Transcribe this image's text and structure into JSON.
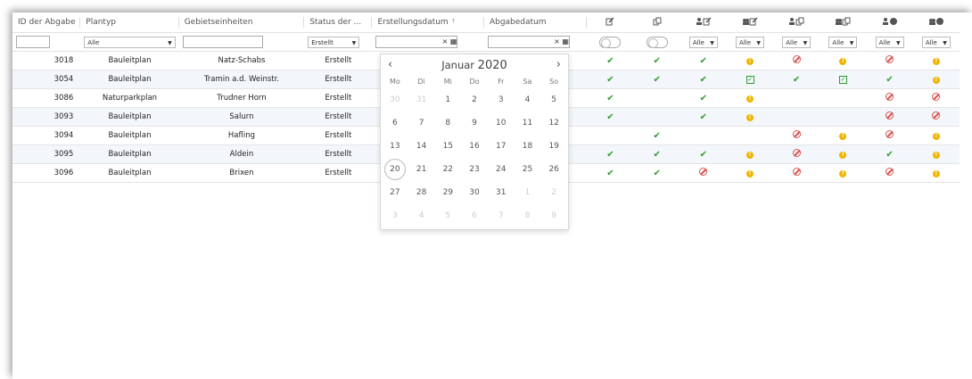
{
  "columns": [
    {
      "label": "ID der Abgabe"
    },
    {
      "label": "Plantyp"
    },
    {
      "label": "Gebietseinheiten"
    },
    {
      "label": "Status der ..."
    },
    {
      "label": "Erstellungsdatum",
      "sort": "↑"
    },
    {
      "label": "Abgabedatum"
    }
  ],
  "icon_columns": [
    "edit-icon",
    "copy-icon",
    "user-edit-icon",
    "group-edit-icon",
    "user-copy-icon",
    "group-copy-icon",
    "user-status-icon",
    "group-status-icon"
  ],
  "filters": {
    "plantyp": "Alle",
    "status": "Erstellt",
    "dropdowns": [
      "Alle",
      "Alle",
      "Alle",
      "Alle",
      "Alle",
      "Alle"
    ],
    "date_clear": "×",
    "date_cal": "▦"
  },
  "rows": [
    {
      "id": "3018",
      "plantyp": "Bauleitplan",
      "gebiet": "Natz-Schabs",
      "status": "Erstellt",
      "icons": [
        "ok",
        "ok",
        "ok",
        "warn",
        "no",
        "warn",
        "no",
        "warn"
      ]
    },
    {
      "id": "3054",
      "plantyp": "Bauleitplan",
      "gebiet": "Tramin a.d. Weinstr.",
      "status": "Erstellt",
      "icons": [
        "ok",
        "ok",
        "ok",
        "chk",
        "ok",
        "chk",
        "ok",
        "warn"
      ]
    },
    {
      "id": "3086",
      "plantyp": "Naturparkplan",
      "gebiet": "Trudner Horn",
      "status": "Erstellt",
      "icons": [
        "ok",
        "",
        "ok",
        "warn",
        "",
        "",
        "no",
        "no"
      ]
    },
    {
      "id": "3093",
      "plantyp": "Bauleitplan",
      "gebiet": "Salurn",
      "status": "Erstellt",
      "icons": [
        "ok",
        "",
        "ok",
        "warn",
        "",
        "",
        "no",
        "no"
      ]
    },
    {
      "id": "3094",
      "plantyp": "Bauleitplan",
      "gebiet": "Hafling",
      "status": "Erstellt",
      "icons": [
        "",
        "ok",
        "",
        "",
        "no",
        "warn",
        "no",
        "warn"
      ]
    },
    {
      "id": "3095",
      "plantyp": "Bauleitplan",
      "gebiet": "Aldein",
      "status": "Erstellt",
      "icons": [
        "ok",
        "ok",
        "ok",
        "warn",
        "no",
        "warn",
        "ok",
        "warn"
      ]
    },
    {
      "id": "3096",
      "plantyp": "Bauleitplan",
      "gebiet": "Brixen",
      "status": "Erstellt",
      "icons": [
        "ok",
        "ok",
        "no",
        "warn",
        "no",
        "warn",
        "no",
        "warn"
      ]
    }
  ],
  "datepicker": {
    "month": "Januar",
    "year": "2020",
    "prev": "‹",
    "next": "›",
    "weekdays": [
      "Mo",
      "Di",
      "Mi",
      "Do",
      "Fr",
      "Sa",
      "So"
    ],
    "weeks": [
      [
        {
          "d": "30",
          "m": true
        },
        {
          "d": "31",
          "m": true
        },
        {
          "d": "1"
        },
        {
          "d": "2"
        },
        {
          "d": "3"
        },
        {
          "d": "4"
        },
        {
          "d": "5"
        }
      ],
      [
        {
          "d": "6"
        },
        {
          "d": "7"
        },
        {
          "d": "8"
        },
        {
          "d": "9"
        },
        {
          "d": "10"
        },
        {
          "d": "11"
        },
        {
          "d": "12"
        }
      ],
      [
        {
          "d": "13"
        },
        {
          "d": "14"
        },
        {
          "d": "15"
        },
        {
          "d": "16"
        },
        {
          "d": "17"
        },
        {
          "d": "18"
        },
        {
          "d": "19"
        }
      ],
      [
        {
          "d": "20",
          "today": true
        },
        {
          "d": "21"
        },
        {
          "d": "22"
        },
        {
          "d": "23"
        },
        {
          "d": "24"
        },
        {
          "d": "25"
        },
        {
          "d": "26"
        }
      ],
      [
        {
          "d": "27"
        },
        {
          "d": "28"
        },
        {
          "d": "29"
        },
        {
          "d": "30"
        },
        {
          "d": "31"
        },
        {
          "d": "1",
          "m": true
        },
        {
          "d": "2",
          "m": true
        }
      ],
      [
        {
          "d": "3",
          "m": true
        },
        {
          "d": "4",
          "m": true
        },
        {
          "d": "5",
          "m": true
        },
        {
          "d": "6",
          "m": true
        },
        {
          "d": "7",
          "m": true
        },
        {
          "d": "8",
          "m": true
        },
        {
          "d": "9",
          "m": true
        }
      ]
    ]
  },
  "colors": {
    "ok": "#2f9e2f",
    "warn": "#f0b400",
    "no": "#d9534f",
    "row_alt": "#f3f6fb"
  }
}
